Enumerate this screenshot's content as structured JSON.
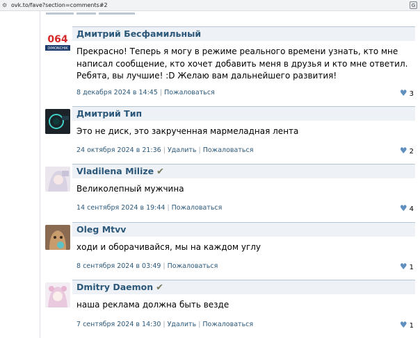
{
  "browser": {
    "url": "ovk.to/fave?section=comments#2"
  },
  "icons": {
    "settings": "tune-icon",
    "translate": "translate-icon",
    "like": "heart-icon",
    "verified": "checkmark-icon"
  },
  "colors": {
    "link": "#2b587a",
    "header_bg": "#eef1f5",
    "header_border": "#b6c5d3",
    "heart": "#5f8fbe"
  },
  "comments": [
    {
      "author": "Дмитрий Бесфамильный",
      "verified": false,
      "avatar_text_big": "064",
      "avatar_text_small": "DIMONCHIK",
      "text": "Прекрасно! Теперь я могу в режиме реального времени узнать, кто мне написал сообщение, кто хочет добавить меня в друзья и кто мне ответил. Ребята, вы лучшие! :D Желаю вам дальнейшего развития!",
      "date": "8 декабря 2024 в 14:45",
      "actions": [
        "Пожаловаться"
      ],
      "likes": "3"
    },
    {
      "author": "Дмитрий Тип",
      "verified": false,
      "text": "Это не диск, это закрученная мармеладная лента",
      "date": "24 октября 2024 в 21:36",
      "actions": [
        "Удалить",
        "Пожаловаться"
      ],
      "likes": "2"
    },
    {
      "author": "Vladilena Milize",
      "verified": true,
      "text": "Великолепный мужчина",
      "date": "14 сентября 2024 в 19:44",
      "actions": [
        "Пожаловаться"
      ],
      "likes": "4"
    },
    {
      "author": "Oleg Mtvv",
      "verified": false,
      "text": "ходи и оборачивайся, мы на каждом углу",
      "date": "8 сентября 2024 в 03:49",
      "actions": [
        "Пожаловаться"
      ],
      "likes": "1"
    },
    {
      "author": "Dmitry Daemon",
      "verified": true,
      "text": "наша реклама должна быть везде",
      "date": "7 сентября 2024 в 14:30",
      "actions": [
        "Удалить",
        "Пожаловаться"
      ],
      "likes": "1"
    }
  ]
}
